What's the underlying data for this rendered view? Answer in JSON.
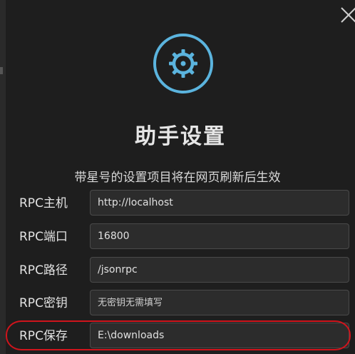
{
  "dialog": {
    "title": "助手设置",
    "hint": "带星号的设置项目将在网页刷新后生效",
    "close_icon": "close-icon",
    "logo_icon": "gear-icon"
  },
  "colors": {
    "accent": "#5bb4de",
    "background": "#1e1e1e",
    "input_background": "#2c2c2c",
    "highlight": "#d0141c"
  },
  "fields": [
    {
      "label": "RPC主机",
      "value": "http://localhost",
      "placeholder": ""
    },
    {
      "label": "RPC端口",
      "value": "16800",
      "placeholder": ""
    },
    {
      "label": "RPC路径",
      "value": "/jsonrpc",
      "placeholder": ""
    },
    {
      "label": "RPC密钥",
      "value": "",
      "placeholder": "无密钥无需填写"
    },
    {
      "label": "RPC保存",
      "value": "E:\\downloads",
      "placeholder": ""
    }
  ]
}
